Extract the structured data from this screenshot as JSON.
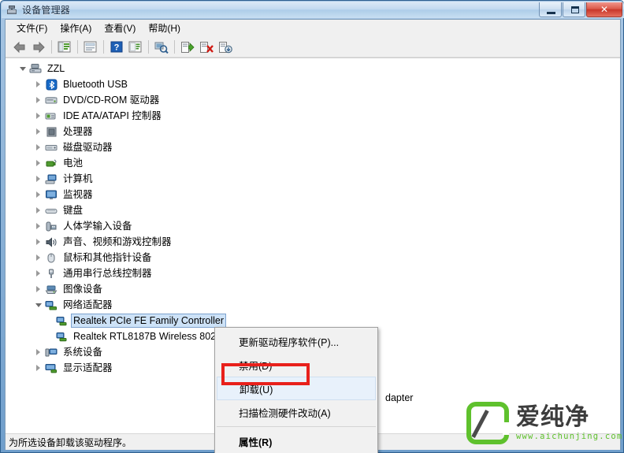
{
  "window": {
    "title": "设备管理器",
    "title_icon": "device-manager-icon",
    "buttons": {
      "minimize": "minimize-icon",
      "maximize": "maximize-icon",
      "close": "✕"
    }
  },
  "menubar": {
    "items": [
      {
        "label": "文件(F)",
        "name": "menu-file"
      },
      {
        "label": "操作(A)",
        "name": "menu-action"
      },
      {
        "label": "查看(V)",
        "name": "menu-view"
      },
      {
        "label": "帮助(H)",
        "name": "menu-help"
      }
    ]
  },
  "toolbar": {
    "items": [
      {
        "name": "back-icon",
        "tip": "后退"
      },
      {
        "name": "forward-icon",
        "tip": "前进"
      },
      {
        "name": "show-hide-tree-icon",
        "tip": "显示/隐藏控制台树"
      },
      {
        "name": "properties-icon",
        "tip": "属性"
      },
      {
        "name": "help-icon",
        "tip": "帮助"
      },
      {
        "name": "display-icon",
        "tip": "显示"
      },
      {
        "name": "scan-hardware-icon",
        "tip": "扫描检测硬件改动"
      },
      {
        "name": "update-driver-icon",
        "tip": "更新驱动程序软件"
      },
      {
        "name": "disable-device-icon",
        "tip": "禁用"
      },
      {
        "name": "uninstall-device-icon",
        "tip": "卸载"
      }
    ]
  },
  "tree": {
    "root": {
      "label": "ZZL",
      "icon": "computer-icon",
      "expanded": true
    },
    "nodes": [
      {
        "label": "Bluetooth USB",
        "icon": "bluetooth-icon",
        "expanded": false,
        "level": 1
      },
      {
        "label": "DVD/CD-ROM 驱动器",
        "icon": "dvd-drive-icon",
        "expanded": false,
        "level": 1
      },
      {
        "label": "IDE ATA/ATAPI 控制器",
        "icon": "ide-controller-icon",
        "expanded": false,
        "level": 1
      },
      {
        "label": "处理器",
        "icon": "processor-icon",
        "expanded": false,
        "level": 1
      },
      {
        "label": "磁盘驱动器",
        "icon": "disk-drive-icon",
        "expanded": false,
        "level": 1
      },
      {
        "label": "电池",
        "icon": "battery-icon",
        "expanded": false,
        "level": 1
      },
      {
        "label": "计算机",
        "icon": "computer-node-icon",
        "expanded": false,
        "level": 1
      },
      {
        "label": "监视器",
        "icon": "monitor-icon",
        "expanded": false,
        "level": 1
      },
      {
        "label": "键盘",
        "icon": "keyboard-icon",
        "expanded": false,
        "level": 1
      },
      {
        "label": "人体学输入设备",
        "icon": "hid-icon",
        "expanded": false,
        "level": 1
      },
      {
        "label": "声音、视频和游戏控制器",
        "icon": "sound-icon",
        "expanded": false,
        "level": 1
      },
      {
        "label": "鼠标和其他指针设备",
        "icon": "mouse-icon",
        "expanded": false,
        "level": 1
      },
      {
        "label": "通用串行总线控制器",
        "icon": "usb-icon",
        "expanded": false,
        "level": 1
      },
      {
        "label": "图像设备",
        "icon": "imaging-icon",
        "expanded": false,
        "level": 1
      },
      {
        "label": "网络适配器",
        "icon": "network-adapter-icon",
        "expanded": true,
        "level": 1
      },
      {
        "label": "Realtek PCIe FE Family Controller",
        "icon": "network-device-icon",
        "expanded": false,
        "level": 2,
        "selected": true
      },
      {
        "label": "Realtek RTL8187B Wireless 802",
        "icon": "network-device-icon",
        "expanded": false,
        "level": 2
      },
      {
        "label": "系统设备",
        "icon": "system-device-icon",
        "expanded": false,
        "level": 1
      },
      {
        "label": "显示适配器",
        "icon": "display-adapter-icon",
        "expanded": false,
        "level": 1
      }
    ],
    "occluded_text": "dapter"
  },
  "context_menu": {
    "items": [
      {
        "label": "更新驱动程序软件(P)...",
        "name": "ctx-update-driver",
        "bold": false,
        "highlight": false
      },
      {
        "label": "禁用(D)",
        "name": "ctx-disable",
        "bold": false,
        "highlight": false
      },
      {
        "label": "卸载(U)",
        "name": "ctx-uninstall",
        "bold": false,
        "highlight": true
      },
      {
        "label": "扫描检测硬件改动(A)",
        "name": "ctx-scan-hardware",
        "bold": false,
        "highlight": false
      },
      {
        "label": "属性(R)",
        "name": "ctx-properties",
        "bold": true,
        "highlight": false
      }
    ],
    "annotation_color": "#e8201b"
  },
  "status_bar": {
    "text": "为所选设备卸载该驱动程序。"
  },
  "watermark": {
    "brand": "爱纯净",
    "url": "www.aichunjing.com",
    "color": "#5fc12d"
  }
}
